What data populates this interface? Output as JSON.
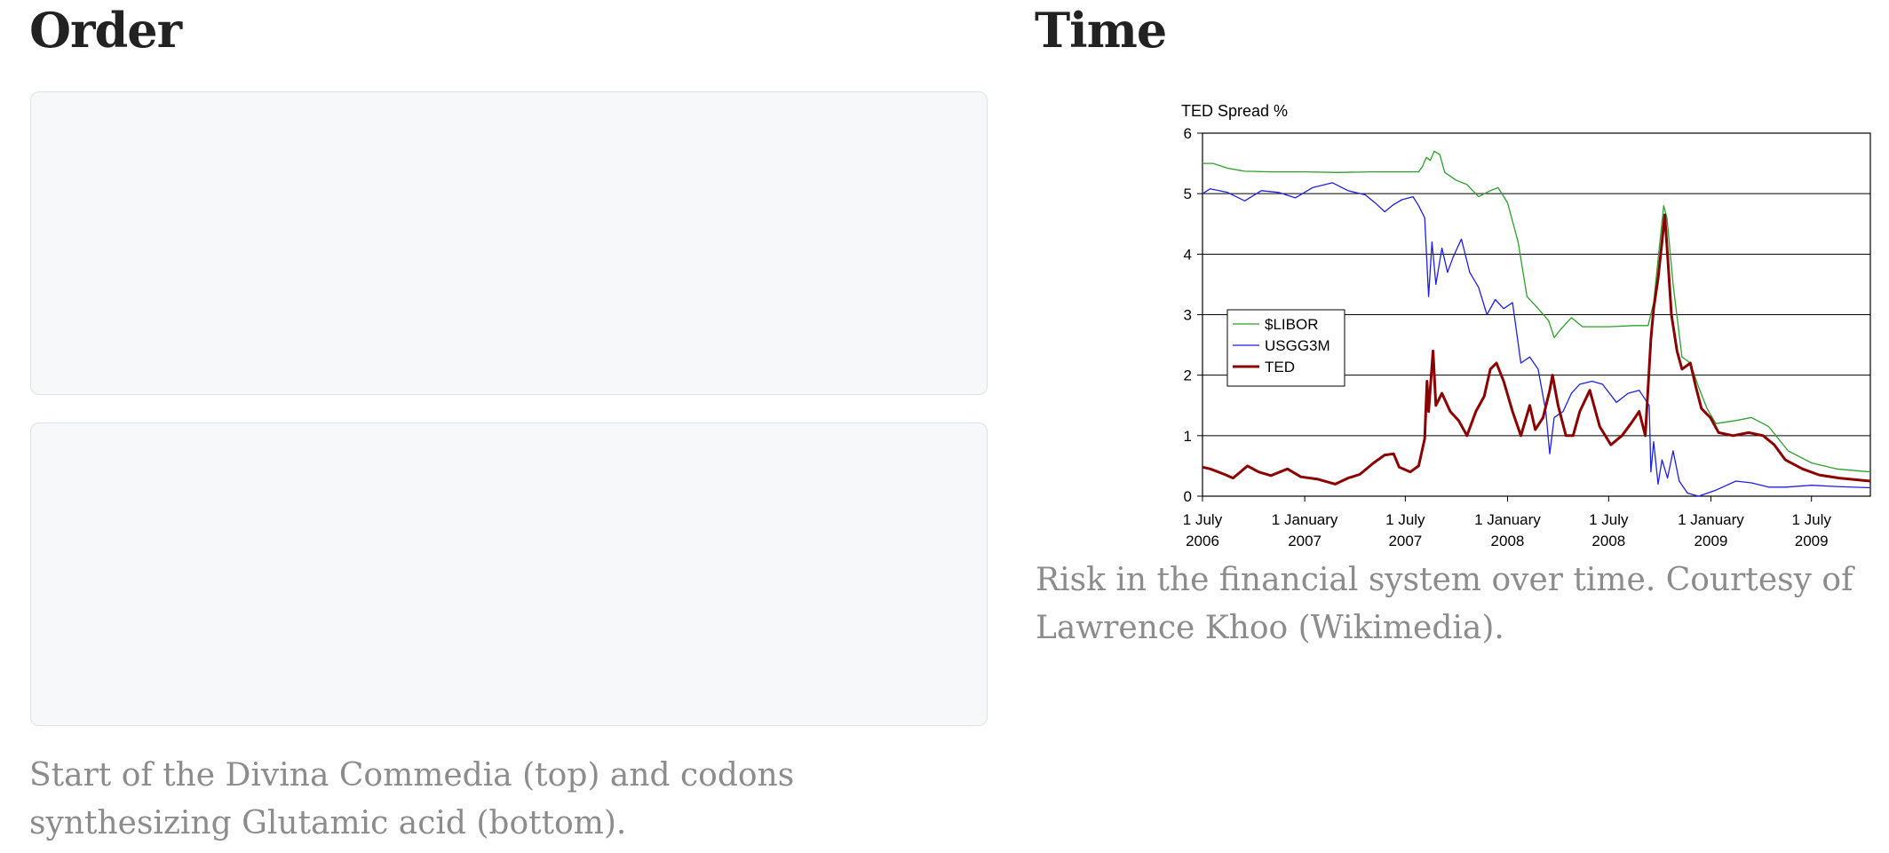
{
  "sections": {
    "order": {
      "title": "Order",
      "caption": "Start of the Divina Commedia (top) and codons synthesizing Glutamic acid (bottom)."
    },
    "time": {
      "title": "Time",
      "caption": "Risk in the financial system over time. Courtesy of Lawrence Khoo (Wikimedia)."
    }
  },
  "chart_data": {
    "type": "line",
    "title": "TED Spread %",
    "xlabel": "",
    "ylabel": "",
    "ylim": [
      0,
      6
    ],
    "xlim": [
      "2006-07-01",
      "2009-10-15"
    ],
    "yticks": [
      0,
      1,
      2,
      3,
      4,
      5,
      6
    ],
    "xticks": [
      {
        "date": "2006-07-01",
        "line1": "1 July",
        "line2": "2006"
      },
      {
        "date": "2007-01-01",
        "line1": "1 January",
        "line2": "2007"
      },
      {
        "date": "2007-07-01",
        "line1": "1 July",
        "line2": "2007"
      },
      {
        "date": "2008-01-01",
        "line1": "1 January",
        "line2": "2008"
      },
      {
        "date": "2008-07-01",
        "line1": "1 July",
        "line2": "2008"
      },
      {
        "date": "2009-01-01",
        "line1": "1 January",
        "line2": "2009"
      },
      {
        "date": "2009-07-01",
        "line1": "1 July",
        "line2": "2009"
      }
    ],
    "grid": "horizontal",
    "legend": "middle-left",
    "series": [
      {
        "name": "$LIBOR",
        "color": "#2ca02c",
        "points": [
          [
            "2006-07-01",
            5.5
          ],
          [
            "2006-07-20",
            5.5
          ],
          [
            "2006-08-15",
            5.42
          ],
          [
            "2006-09-15",
            5.37
          ],
          [
            "2006-11-01",
            5.36
          ],
          [
            "2007-01-01",
            5.36
          ],
          [
            "2007-03-01",
            5.35
          ],
          [
            "2007-05-01",
            5.36
          ],
          [
            "2007-07-01",
            5.36
          ],
          [
            "2007-07-25",
            5.36
          ],
          [
            "2007-08-01",
            5.45
          ],
          [
            "2007-08-08",
            5.6
          ],
          [
            "2007-08-15",
            5.55
          ],
          [
            "2007-08-22",
            5.7
          ],
          [
            "2007-09-01",
            5.65
          ],
          [
            "2007-09-10",
            5.35
          ],
          [
            "2007-10-01",
            5.22
          ],
          [
            "2007-10-20",
            5.15
          ],
          [
            "2007-11-10",
            4.95
          ],
          [
            "2007-12-01",
            5.05
          ],
          [
            "2007-12-15",
            5.1
          ],
          [
            "2008-01-01",
            4.85
          ],
          [
            "2008-01-20",
            4.2
          ],
          [
            "2008-02-05",
            3.3
          ],
          [
            "2008-02-25",
            3.1
          ],
          [
            "2008-03-15",
            2.9
          ],
          [
            "2008-03-25",
            2.62
          ],
          [
            "2008-04-05",
            2.75
          ],
          [
            "2008-04-25",
            2.95
          ],
          [
            "2008-05-15",
            2.8
          ],
          [
            "2008-07-01",
            2.8
          ],
          [
            "2008-08-15",
            2.82
          ],
          [
            "2008-09-10",
            2.82
          ],
          [
            "2008-09-20",
            3.2
          ],
          [
            "2008-09-30",
            4.1
          ],
          [
            "2008-10-08",
            4.8
          ],
          [
            "2008-10-14",
            4.6
          ],
          [
            "2008-10-25",
            3.5
          ],
          [
            "2008-11-10",
            2.3
          ],
          [
            "2008-11-25",
            2.2
          ],
          [
            "2008-12-10",
            1.8
          ],
          [
            "2008-12-25",
            1.45
          ],
          [
            "2009-01-10",
            1.2
          ],
          [
            "2009-02-15",
            1.25
          ],
          [
            "2009-03-15",
            1.3
          ],
          [
            "2009-04-15",
            1.15
          ],
          [
            "2009-05-20",
            0.75
          ],
          [
            "2009-07-01",
            0.55
          ],
          [
            "2009-08-15",
            0.45
          ],
          [
            "2009-10-15",
            0.4
          ]
        ]
      },
      {
        "name": "USGG3M",
        "color": "#1f1fe6",
        "points": [
          [
            "2006-07-01",
            5.0
          ],
          [
            "2006-07-15",
            5.08
          ],
          [
            "2006-08-15",
            5.02
          ],
          [
            "2006-09-15",
            4.88
          ],
          [
            "2006-10-15",
            5.05
          ],
          [
            "2006-11-15",
            5.02
          ],
          [
            "2006-12-15",
            4.93
          ],
          [
            "2007-01-15",
            5.1
          ],
          [
            "2007-02-20",
            5.18
          ],
          [
            "2007-03-20",
            5.05
          ],
          [
            "2007-04-20",
            4.98
          ],
          [
            "2007-05-10",
            4.83
          ],
          [
            "2007-05-25",
            4.7
          ],
          [
            "2007-06-10",
            4.82
          ],
          [
            "2007-06-25",
            4.9
          ],
          [
            "2007-07-15",
            4.95
          ],
          [
            "2007-07-25",
            4.8
          ],
          [
            "2007-08-05",
            4.6
          ],
          [
            "2007-08-12",
            3.3
          ],
          [
            "2007-08-18",
            4.2
          ],
          [
            "2007-08-25",
            3.5
          ],
          [
            "2007-09-05",
            4.1
          ],
          [
            "2007-09-15",
            3.7
          ],
          [
            "2007-09-25",
            3.95
          ],
          [
            "2007-10-10",
            4.25
          ],
          [
            "2007-10-25",
            3.7
          ],
          [
            "2007-11-10",
            3.45
          ],
          [
            "2007-11-25",
            3.0
          ],
          [
            "2007-12-10",
            3.25
          ],
          [
            "2007-12-25",
            3.1
          ],
          [
            "2008-01-10",
            3.2
          ],
          [
            "2008-01-25",
            2.2
          ],
          [
            "2008-02-10",
            2.3
          ],
          [
            "2008-02-25",
            2.1
          ],
          [
            "2008-03-10",
            1.4
          ],
          [
            "2008-03-17",
            0.7
          ],
          [
            "2008-03-25",
            1.3
          ],
          [
            "2008-04-10",
            1.4
          ],
          [
            "2008-04-25",
            1.7
          ],
          [
            "2008-05-10",
            1.85
          ],
          [
            "2008-06-01",
            1.9
          ],
          [
            "2008-06-20",
            1.85
          ],
          [
            "2008-07-15",
            1.55
          ],
          [
            "2008-08-05",
            1.7
          ],
          [
            "2008-08-25",
            1.75
          ],
          [
            "2008-09-12",
            1.5
          ],
          [
            "2008-09-15",
            0.4
          ],
          [
            "2008-09-20",
            0.9
          ],
          [
            "2008-09-28",
            0.2
          ],
          [
            "2008-10-05",
            0.6
          ],
          [
            "2008-10-15",
            0.3
          ],
          [
            "2008-10-25",
            0.75
          ],
          [
            "2008-11-05",
            0.25
          ],
          [
            "2008-11-20",
            0.05
          ],
          [
            "2008-12-10",
            0.0
          ],
          [
            "2009-01-10",
            0.1
          ],
          [
            "2009-02-15",
            0.25
          ],
          [
            "2009-03-15",
            0.22
          ],
          [
            "2009-04-15",
            0.15
          ],
          [
            "2009-05-15",
            0.15
          ],
          [
            "2009-07-01",
            0.18
          ],
          [
            "2009-08-15",
            0.16
          ],
          [
            "2009-10-15",
            0.14
          ]
        ]
      },
      {
        "name": "TED",
        "color": "#8b0000",
        "points": [
          [
            "2006-07-01",
            0.48
          ],
          [
            "2006-07-15",
            0.45
          ],
          [
            "2006-08-10",
            0.36
          ],
          [
            "2006-08-25",
            0.3
          ],
          [
            "2006-09-20",
            0.5
          ],
          [
            "2006-10-10",
            0.4
          ],
          [
            "2006-11-01",
            0.34
          ],
          [
            "2006-12-01",
            0.45
          ],
          [
            "2006-12-25",
            0.32
          ],
          [
            "2007-01-25",
            0.28
          ],
          [
            "2007-02-25",
            0.2
          ],
          [
            "2007-03-20",
            0.3
          ],
          [
            "2007-04-10",
            0.36
          ],
          [
            "2007-05-05",
            0.55
          ],
          [
            "2007-05-25",
            0.68
          ],
          [
            "2007-06-10",
            0.7
          ],
          [
            "2007-06-20",
            0.48
          ],
          [
            "2007-07-10",
            0.4
          ],
          [
            "2007-07-25",
            0.5
          ],
          [
            "2007-08-05",
            0.95
          ],
          [
            "2007-08-09",
            1.9
          ],
          [
            "2007-08-12",
            1.4
          ],
          [
            "2007-08-20",
            2.4
          ],
          [
            "2007-08-25",
            1.5
          ],
          [
            "2007-09-05",
            1.7
          ],
          [
            "2007-09-20",
            1.4
          ],
          [
            "2007-10-05",
            1.25
          ],
          [
            "2007-10-20",
            1.0
          ],
          [
            "2007-11-05",
            1.4
          ],
          [
            "2007-11-20",
            1.65
          ],
          [
            "2007-12-01",
            2.1
          ],
          [
            "2007-12-12",
            2.2
          ],
          [
            "2007-12-25",
            1.9
          ],
          [
            "2008-01-10",
            1.4
          ],
          [
            "2008-01-25",
            1.0
          ],
          [
            "2008-02-10",
            1.5
          ],
          [
            "2008-02-20",
            1.1
          ],
          [
            "2008-03-05",
            1.3
          ],
          [
            "2008-03-17",
            1.75
          ],
          [
            "2008-03-22",
            2.0
          ],
          [
            "2008-04-01",
            1.5
          ],
          [
            "2008-04-15",
            1.0
          ],
          [
            "2008-04-28",
            1.0
          ],
          [
            "2008-05-10",
            1.4
          ],
          [
            "2008-05-28",
            1.75
          ],
          [
            "2008-06-15",
            1.15
          ],
          [
            "2008-07-05",
            0.85
          ],
          [
            "2008-07-25",
            1.0
          ],
          [
            "2008-08-10",
            1.2
          ],
          [
            "2008-08-25",
            1.4
          ],
          [
            "2008-09-05",
            1.0
          ],
          [
            "2008-09-15",
            2.6
          ],
          [
            "2008-09-20",
            3.1
          ],
          [
            "2008-09-28",
            3.6
          ],
          [
            "2008-10-05",
            4.2
          ],
          [
            "2008-10-10",
            4.65
          ],
          [
            "2008-10-15",
            4.0
          ],
          [
            "2008-10-22",
            3.0
          ],
          [
            "2008-11-01",
            2.4
          ],
          [
            "2008-11-10",
            2.1
          ],
          [
            "2008-11-25",
            2.2
          ],
          [
            "2008-12-05",
            1.8
          ],
          [
            "2008-12-15",
            1.45
          ],
          [
            "2008-12-31",
            1.3
          ],
          [
            "2009-01-15",
            1.05
          ],
          [
            "2009-02-10",
            1.0
          ],
          [
            "2009-03-10",
            1.05
          ],
          [
            "2009-04-05",
            1.0
          ],
          [
            "2009-04-25",
            0.85
          ],
          [
            "2009-05-15",
            0.6
          ],
          [
            "2009-06-15",
            0.45
          ],
          [
            "2009-07-15",
            0.35
          ],
          [
            "2009-08-20",
            0.3
          ],
          [
            "2009-10-15",
            0.25
          ]
        ]
      }
    ]
  }
}
